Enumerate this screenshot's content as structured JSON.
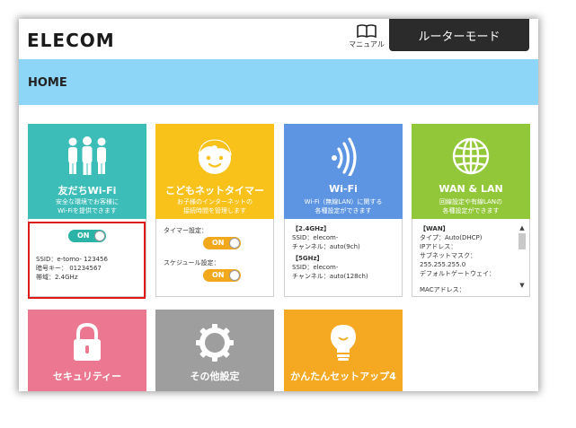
{
  "header": {
    "logo": "ELECOM",
    "manual_label": "マニュアル",
    "mode_button": "ルーターモード",
    "page_title": "HOME"
  },
  "colors": {
    "header_bg": "#8ed6f8",
    "friends_tile": "#3dbdb8",
    "timer_tile": "#f8c21a",
    "wifi_tile": "#5d95e2",
    "wan_tile": "#92c73a",
    "security_tile": "#ec7790",
    "other_tile": "#9e9e9e",
    "setup_tile": "#f5a922",
    "toggle_on": "#2bb3a8",
    "toggle_on_orange": "#f2a81d",
    "highlight": "#e01818"
  },
  "tiles": {
    "friends": {
      "icon": "people-icon",
      "title": "友だちWi-Fi",
      "desc1": "安全な環境でお客様に",
      "desc2": "Wi-Fiを提供できます",
      "toggle": "ON",
      "ssid": "SSID：e-tomo- 123456",
      "key": "暗号キー： 01234567",
      "band": "帯域：2.4GHz"
    },
    "timer": {
      "icon": "child-face-icon",
      "title": "こどもネットタイマー",
      "desc1": "お子様のインターネットの",
      "desc2": "接続時間を管理します",
      "timer_label": "タイマー設定：",
      "timer_toggle": "ON",
      "schedule_label": "スケジュール設定：",
      "schedule_toggle": "ON"
    },
    "wifi": {
      "icon": "wifi-signal-icon",
      "title": "Wi-Fi",
      "desc1": "Wi-Fi（無線LAN）に関する",
      "desc2": "各種設定ができます",
      "band24": "【2.4GHz】",
      "ssid24a": "SSID：elecom-",
      "ch24": "チャンネル：auto(9ch)",
      "band5": "【5GHz】",
      "ssid5a": "SSID：elecom-",
      "ch5": "チャンネル：auto(128ch)"
    },
    "wan": {
      "icon": "globe-icon",
      "title": "WAN & LAN",
      "desc1": "回線設定や有線LANの",
      "desc2": "各種設定ができます",
      "section": "【WAN】",
      "type": "タイプ：Auto(DHCP)",
      "ip": "IPアドレス：",
      "subnet": "サブネットマスク：",
      "subnet_val": "255.255.255.0",
      "gateway": "デフォルトゲートウェイ：",
      "mac": "MACアドレス："
    },
    "security": {
      "icon": "padlock-icon",
      "title": "セキュリティー"
    },
    "other": {
      "icon": "gear-icon",
      "title": "その他設定"
    },
    "setup": {
      "icon": "lightbulb-icon",
      "title": "かんたんセットアップ4"
    }
  }
}
